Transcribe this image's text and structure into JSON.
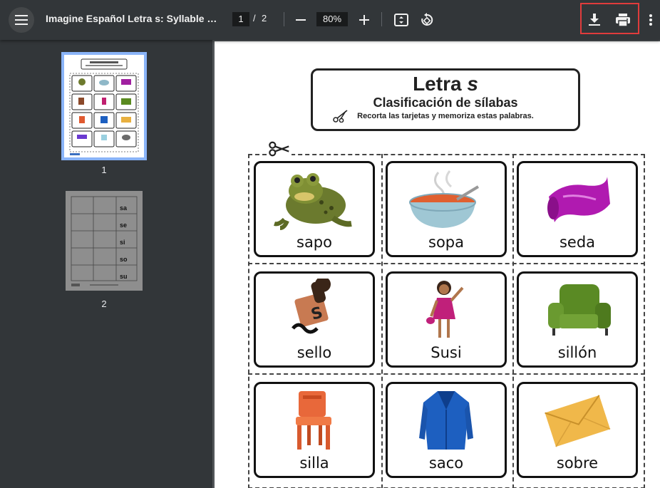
{
  "toolbar": {
    "title": "Imagine Español Letra s: Syllable Sor...",
    "current_page": "1",
    "page_separator": "/",
    "total_pages": "2",
    "zoom": "80%"
  },
  "sidebar": {
    "thumbnails": [
      {
        "label": "1",
        "selected": true
      },
      {
        "label": "2",
        "selected": false
      }
    ],
    "thumb2_syllables": [
      "sa",
      "se",
      "si",
      "so",
      "su"
    ]
  },
  "document": {
    "title_prefix": "Letra ",
    "title_letter": "s",
    "subtitle": "Clasificación de sílabas",
    "instruction": "Recorta las tarjetas y memoriza estas palabras.",
    "cards": [
      {
        "word": "sapo",
        "icon": "frog-icon"
      },
      {
        "word": "sopa",
        "icon": "soup-bowl-icon"
      },
      {
        "word": "seda",
        "icon": "silk-fabric-icon"
      },
      {
        "word": "sello",
        "icon": "rubber-stamp-icon"
      },
      {
        "word": "Susi",
        "icon": "girl-icon"
      },
      {
        "word": "sillón",
        "icon": "armchair-icon"
      },
      {
        "word": "silla",
        "icon": "chair-icon"
      },
      {
        "word": "saco",
        "icon": "jacket-icon"
      },
      {
        "word": "sobre",
        "icon": "envelope-icon"
      }
    ]
  },
  "colors": {
    "toolbar_bg": "#323639",
    "viewer_bg": "#525659",
    "thumb_selected": "#8ab4f8",
    "highlight_border": "#e03c3c"
  }
}
